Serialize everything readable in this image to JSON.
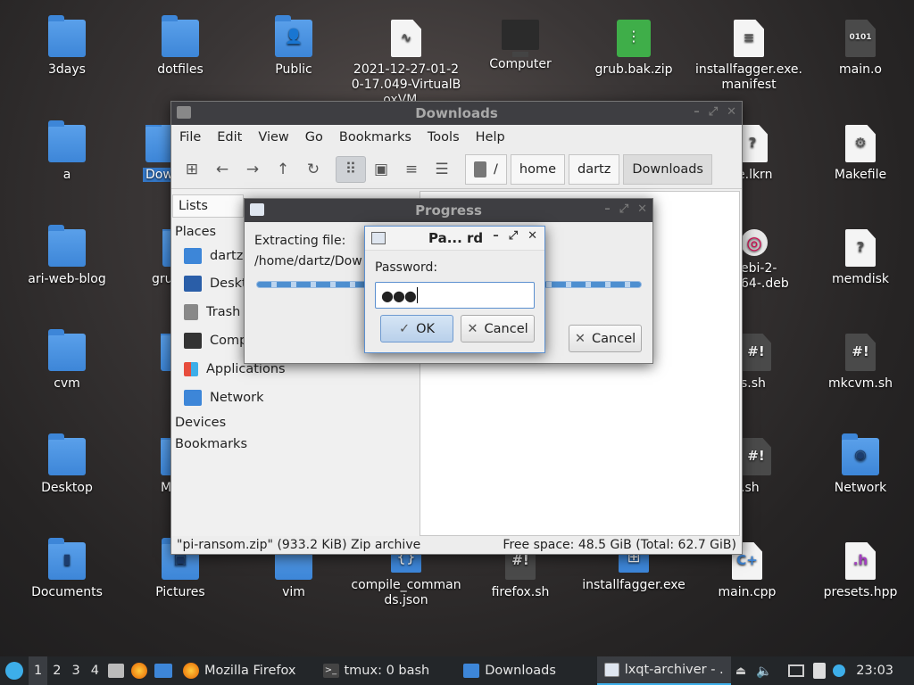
{
  "desktop": {
    "icons": [
      {
        "label": "3days",
        "kind": "folder"
      },
      {
        "label": "dotfiles",
        "kind": "folder"
      },
      {
        "label": "Public",
        "kind": "folder",
        "glyph": "person-icon"
      },
      {
        "label": "2021-12-27-01-20-17.049-VirtualBoxVM...",
        "kind": "doc"
      },
      {
        "label": "Computer",
        "kind": "monitor"
      },
      {
        "label": "grub.bak.zip",
        "kind": "zip"
      },
      {
        "label": "installfagger.exe.manifest",
        "kind": "doc"
      },
      {
        "label": "main.o",
        "kind": "doc"
      },
      {
        "label": "a",
        "kind": "folder"
      },
      {
        "label": "Dow",
        "kind": "folder",
        "selected": true
      },
      {
        "label": "e.lkrn",
        "kind": "doc"
      },
      {
        "label": "Makefile",
        "kind": "doc"
      },
      {
        "label": "ari-web-blog",
        "kind": "folder"
      },
      {
        "label": "gru",
        "kind": "folder"
      },
      {
        "label": "ebi-2-64-.deb",
        "kind": "deb"
      },
      {
        "label": "memdisk",
        "kind": "doc"
      },
      {
        "label": "cvm",
        "kind": "folder"
      },
      {
        "label": "s.sh",
        "kind": "doc"
      },
      {
        "label": "mkcvm.sh",
        "kind": "doc"
      },
      {
        "label": "Desktop",
        "kind": "folder"
      },
      {
        "label": "M",
        "kind": "folder"
      },
      {
        "label": ".sh",
        "kind": "doc"
      },
      {
        "label": "Network",
        "kind": "folder"
      },
      {
        "label": "Documents",
        "kind": "folder"
      },
      {
        "label": "Pictures",
        "kind": "folder"
      },
      {
        "label": "vim",
        "kind": "folder"
      },
      {
        "label": "compile_commands.json",
        "kind": "doc"
      },
      {
        "label": "firefox.sh",
        "kind": "doc"
      },
      {
        "label": "installfagger.exe",
        "kind": "doc"
      },
      {
        "label": "main.cpp",
        "kind": "doc"
      },
      {
        "label": "presets.hpp",
        "kind": "doc"
      }
    ]
  },
  "file_manager": {
    "title": "Downloads",
    "menu": [
      "File",
      "Edit",
      "View",
      "Go",
      "Bookmarks",
      "Tools",
      "Help"
    ],
    "path": [
      "/",
      "home",
      "dartz",
      "Downloads"
    ],
    "sidebar_mode": "Lists",
    "places_header": "Places",
    "places": [
      "dartz",
      "Desktop",
      "Trash",
      "Computer",
      "Applications",
      "Network"
    ],
    "devices_header": "Devices",
    "bookmarks_header": "Bookmarks",
    "status_left": "\"pi-ransom.zip\" (933.2 KiB) Zip archive",
    "status_right": "Free space: 48.5 GiB (Total: 62.7 GiB)"
  },
  "progress": {
    "title": "Progress",
    "extracting_label": "Extracting file:",
    "path": "/home/dartz/Dow",
    "cancel": "Cancel"
  },
  "password_dialog": {
    "title": "Pa... rd",
    "label": "Password:",
    "value": "●●●",
    "ok": "OK",
    "cancel": "Cancel"
  },
  "taskbar": {
    "workspaces": [
      "1",
      "2",
      "3",
      "4"
    ],
    "tasks": [
      {
        "label": "Mozilla Firefox",
        "icon": "firefox-icon"
      },
      {
        "label": "tmux: 0 bash",
        "icon": "terminal-icon"
      },
      {
        "label": "Downloads",
        "icon": "folder-icon"
      },
      {
        "label": "lxqt-archiver - ...",
        "icon": "archiver-icon",
        "active": true
      }
    ],
    "clock": "23:03"
  }
}
